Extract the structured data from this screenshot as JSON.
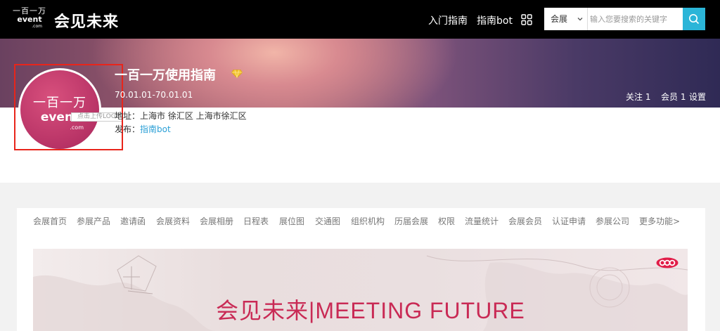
{
  "header": {
    "logo": {
      "line1": "一百一万",
      "line2": "event",
      "line3": ".com"
    },
    "slogan": "会见未来",
    "nav": {
      "guide": "入门指南",
      "bot": "指南bot"
    },
    "apps_icon": "grid-apps-icon",
    "search": {
      "category": "会展",
      "placeholder": "输入您要搜索的关键字",
      "button_icon": "search-icon"
    }
  },
  "profile": {
    "name": "一百一万使用指南",
    "badge_icon": "diamond-icon",
    "dates": "70.01.01-70.01.01",
    "address": "地址：上海市 徐汇区 上海市徐汇区",
    "publisher_label": "发布：",
    "publisher": "指南bot",
    "upload_tip": "点击上传LOGO",
    "avatar": {
      "line1": "一百一万",
      "line2": "event",
      "line3": ".com"
    },
    "stats": {
      "follow": "关注 1",
      "members": "会员 1",
      "settings": "设置"
    }
  },
  "tabs": [
    "会展首页",
    "参展产品",
    "邀请函",
    "会展资料",
    "会展相册",
    "日程表",
    "展位图",
    "交通图",
    "组织机构",
    "历届会展",
    "权限",
    "流量统计",
    "会展会员",
    "认证申请",
    "参展公司",
    "更多功能>"
  ],
  "hero": {
    "text": "会见未来|MEETING FUTURE",
    "logo_icon": "event-logo-icon",
    "colors": {
      "accent": "#c92a55"
    }
  },
  "colors": {
    "topbar": "#000000",
    "search_button": "#2bb5d8",
    "link": "#2a9fd6",
    "highlight_border": "#e8251b"
  }
}
